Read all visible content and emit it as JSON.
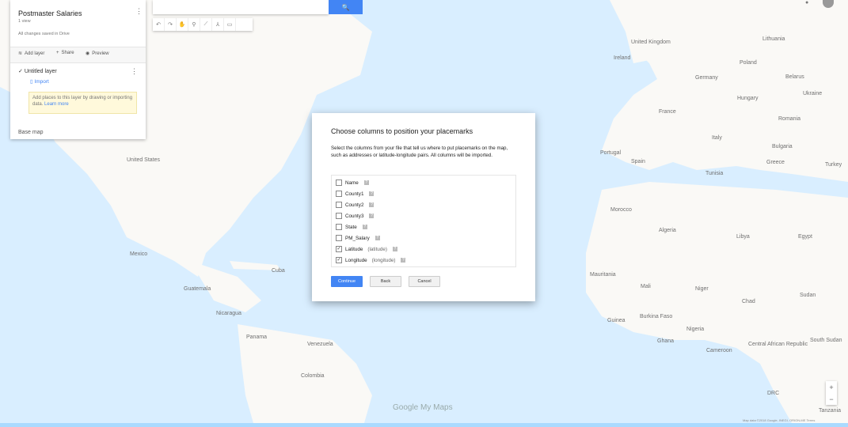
{
  "map": {
    "labels": [
      {
        "text": "Lithuania",
        "cls": "country",
        "pos": "l1"
      },
      {
        "text": "United Kingdom",
        "cls": "country",
        "pos": "l2"
      },
      {
        "text": "Poland",
        "cls": "country",
        "pos": "l3"
      },
      {
        "text": "Germany",
        "cls": "country",
        "pos": "l4"
      },
      {
        "text": "Ukraine",
        "cls": "country",
        "pos": "l5"
      },
      {
        "text": "France",
        "cls": "country",
        "pos": "l6"
      },
      {
        "text": "Romania",
        "cls": "country",
        "pos": "l7"
      },
      {
        "text": "Italy",
        "cls": "country",
        "pos": "l8"
      },
      {
        "text": "Bulgaria",
        "cls": "country",
        "pos": "l9"
      },
      {
        "text": "Portugal",
        "cls": "country",
        "pos": "l10"
      },
      {
        "text": "Spain",
        "cls": "country",
        "pos": "l11"
      },
      {
        "text": "Greece",
        "cls": "country",
        "pos": "l12"
      },
      {
        "text": "Turkey",
        "cls": "country",
        "pos": "l13"
      },
      {
        "text": "Morocco",
        "cls": "country",
        "pos": "l14"
      },
      {
        "text": "Algeria",
        "cls": "country",
        "pos": "l15"
      },
      {
        "text": "Libya",
        "cls": "country",
        "pos": "l16"
      },
      {
        "text": "Egypt",
        "cls": "country",
        "pos": "l17"
      },
      {
        "text": "Mauritania",
        "cls": "country",
        "pos": "l18"
      },
      {
        "text": "Mali",
        "cls": "country",
        "pos": "l19"
      },
      {
        "text": "Niger",
        "cls": "country",
        "pos": "l20"
      },
      {
        "text": "Chad",
        "cls": "country",
        "pos": "l21"
      },
      {
        "text": "Sudan",
        "cls": "country",
        "pos": "l22"
      },
      {
        "text": "Nigeria",
        "cls": "country",
        "pos": "l23"
      },
      {
        "text": "Cameroon",
        "cls": "country",
        "pos": "l24"
      },
      {
        "text": "South Sudan",
        "cls": "country",
        "pos": "l25"
      },
      {
        "text": "Central African Republic",
        "cls": "country",
        "pos": "l26"
      },
      {
        "text": "DRC",
        "cls": "country",
        "pos": "l27"
      },
      {
        "text": "Tanzania",
        "cls": "country",
        "pos": "l28"
      },
      {
        "text": "United States",
        "cls": "country",
        "pos": "l29"
      },
      {
        "text": "Mexico",
        "cls": "country",
        "pos": "l30"
      },
      {
        "text": "Venezuela",
        "cls": "country",
        "pos": "l31"
      },
      {
        "text": "Colombia",
        "cls": "country",
        "pos": "l32"
      },
      {
        "text": "Cuba",
        "cls": "country",
        "pos": "l33"
      },
      {
        "text": "Ireland",
        "cls": "country",
        "pos": "l34"
      },
      {
        "text": "Belarus",
        "cls": "country",
        "pos": "l35"
      },
      {
        "text": "Hungary",
        "cls": "country",
        "pos": "l36"
      },
      {
        "text": "Tunisia",
        "cls": "country",
        "pos": "l37"
      },
      {
        "text": "Guinea",
        "cls": "country",
        "pos": "l38"
      },
      {
        "text": "Ghana",
        "cls": "country",
        "pos": "l39"
      },
      {
        "text": "Burkina Faso",
        "cls": "country",
        "pos": "l40"
      },
      {
        "text": "Guatemala",
        "cls": "country",
        "pos": "l41"
      },
      {
        "text": "Nicaragua",
        "cls": "country",
        "pos": "l42"
      },
      {
        "text": "Panama",
        "cls": "country",
        "pos": "l43"
      }
    ]
  },
  "panel": {
    "title": "Postmaster Salaries",
    "views": "1 view",
    "saved": "All changes saved in Drive",
    "menu_icon": "⋮",
    "toolbar": {
      "add_layer": "Add layer",
      "share": "Share",
      "preview": "Preview"
    },
    "layer_name": "Untitled layer",
    "import_label": "Import",
    "hint_text": "Add places to this layer by drawing or importing data.",
    "hint_link": "Learn more",
    "base_map": "Base map"
  },
  "search": {
    "button_icon": "🔍"
  },
  "dialog": {
    "title": "Choose columns to position your placemarks",
    "description": "Select the columns from your file that tell us where to put placemarks on the map, such as addresses or latitude-longitude pairs. All columns will be imported.",
    "columns": [
      {
        "name": "Name",
        "hint": "",
        "checked": false
      },
      {
        "name": "County1",
        "hint": "",
        "checked": false
      },
      {
        "name": "County2",
        "hint": "",
        "checked": false
      },
      {
        "name": "County3",
        "hint": "",
        "checked": false
      },
      {
        "name": "State",
        "hint": "",
        "checked": false
      },
      {
        "name": "PM_Salary",
        "hint": "",
        "checked": false
      },
      {
        "name": "Latitude",
        "hint": "(latitude)",
        "checked": true
      },
      {
        "name": "Longitude",
        "hint": "(longitude)",
        "checked": true
      }
    ],
    "help_glyph": "?",
    "check_glyph": "✓",
    "buttons": {
      "continue": "Continue",
      "back": "Back",
      "cancel": "Cancel"
    }
  },
  "map_controls": {
    "zoom_in": "+",
    "zoom_out": "−",
    "google_logo": "Google My Maps",
    "attribution": "Map data ©2018 Google, INEGI, ORION-ME  Terms"
  },
  "colors": {
    "accent": "#4285f4",
    "land": "#f4f1ea",
    "water": "#aadaff"
  }
}
